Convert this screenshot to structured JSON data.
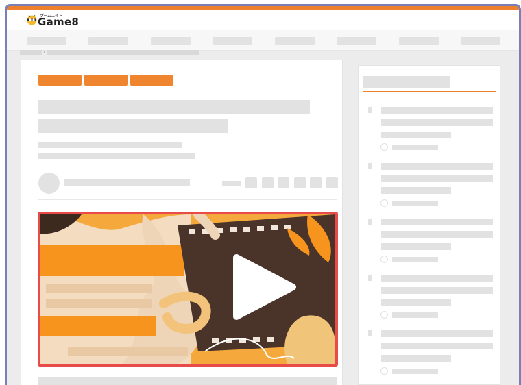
{
  "site": {
    "logo_katakana": "ゲームエイト",
    "logo_word": "Game8",
    "accent_color": "#ee7f2d",
    "video_border_color": "#e94b4b",
    "frame_color": "#7b7fb3"
  },
  "nav": {
    "item_count": 8
  },
  "article": {
    "tag_count": 3,
    "share_button_count": 6
  },
  "video": {
    "play_icon": "play-icon"
  },
  "sidebar": {
    "item_count": 5
  }
}
